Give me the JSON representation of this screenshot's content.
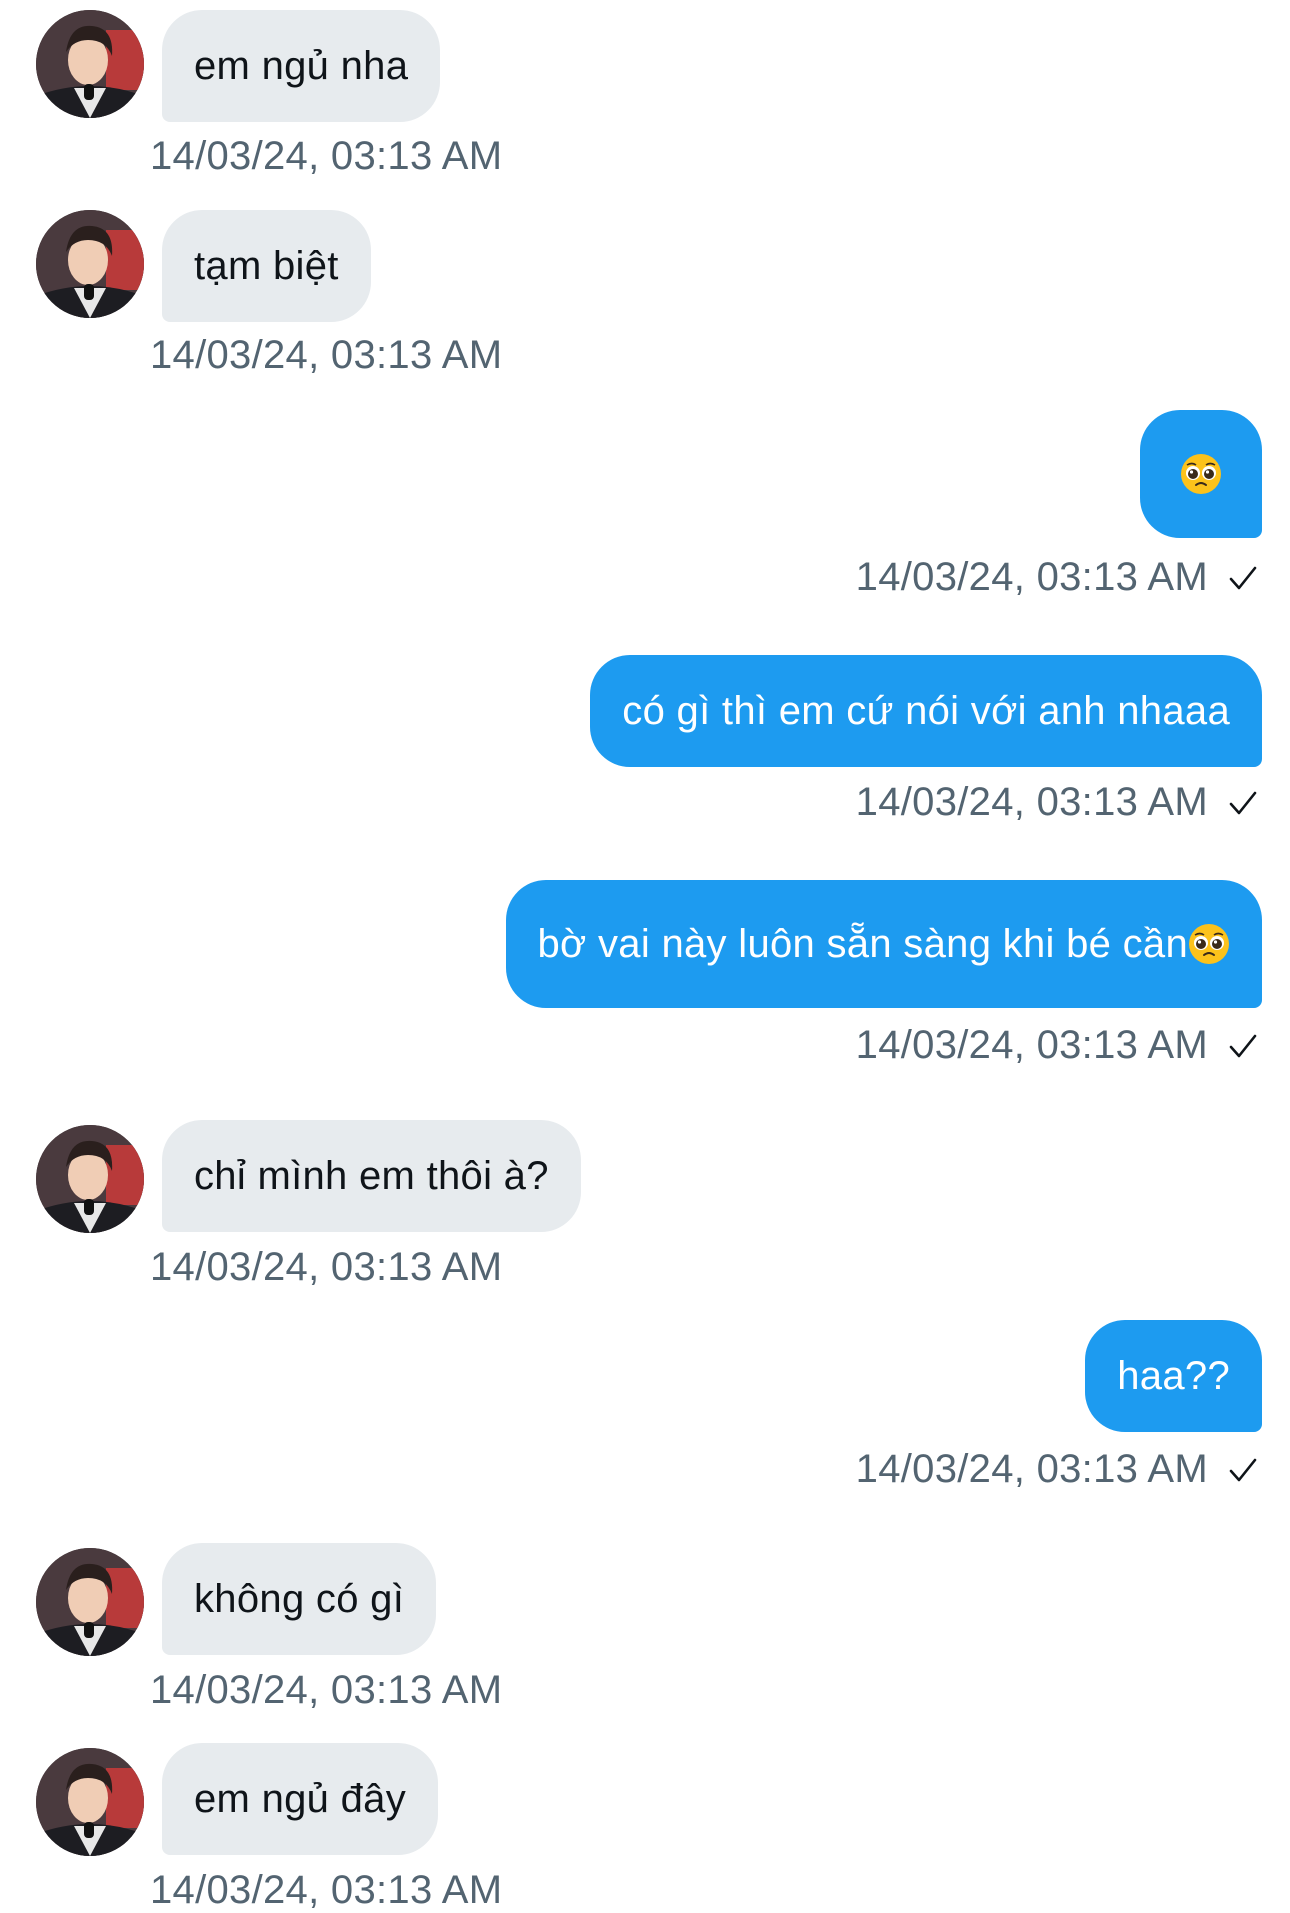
{
  "messages": [
    {
      "side": "in",
      "text": "em ngủ nha",
      "time": "14/03/24, 03:13 AM"
    },
    {
      "side": "in",
      "text": "tạm biệt",
      "time": "14/03/24, 03:13 AM"
    },
    {
      "side": "out",
      "text": "",
      "emoji": "pleading-face",
      "time": "14/03/24, 03:13 AM"
    },
    {
      "side": "out",
      "text": "có gì thì em cứ nói với anh nhaaa",
      "time": "14/03/24, 03:13 AM"
    },
    {
      "side": "out",
      "text": "bờ vai này luôn sẵn sàng khi bé cần",
      "emoji": "pleading-face",
      "time": "14/03/24, 03:13 AM"
    },
    {
      "side": "in",
      "text": "chỉ mình em thôi à?",
      "time": "14/03/24, 03:13 AM"
    },
    {
      "side": "out",
      "text": "haa??",
      "time": "14/03/24, 03:13 AM"
    },
    {
      "side": "in",
      "text": "không có gì",
      "time": "14/03/24, 03:13 AM"
    },
    {
      "side": "in",
      "text": "em ngủ đây",
      "time": "14/03/24, 03:13 AM"
    }
  ],
  "colors": {
    "incoming_bubble": "#e7ebee",
    "outgoing_bubble": "#1d9bf0",
    "timestamp": "#536471"
  },
  "icons": {
    "sent": "check-icon",
    "avatar": "avatar"
  }
}
